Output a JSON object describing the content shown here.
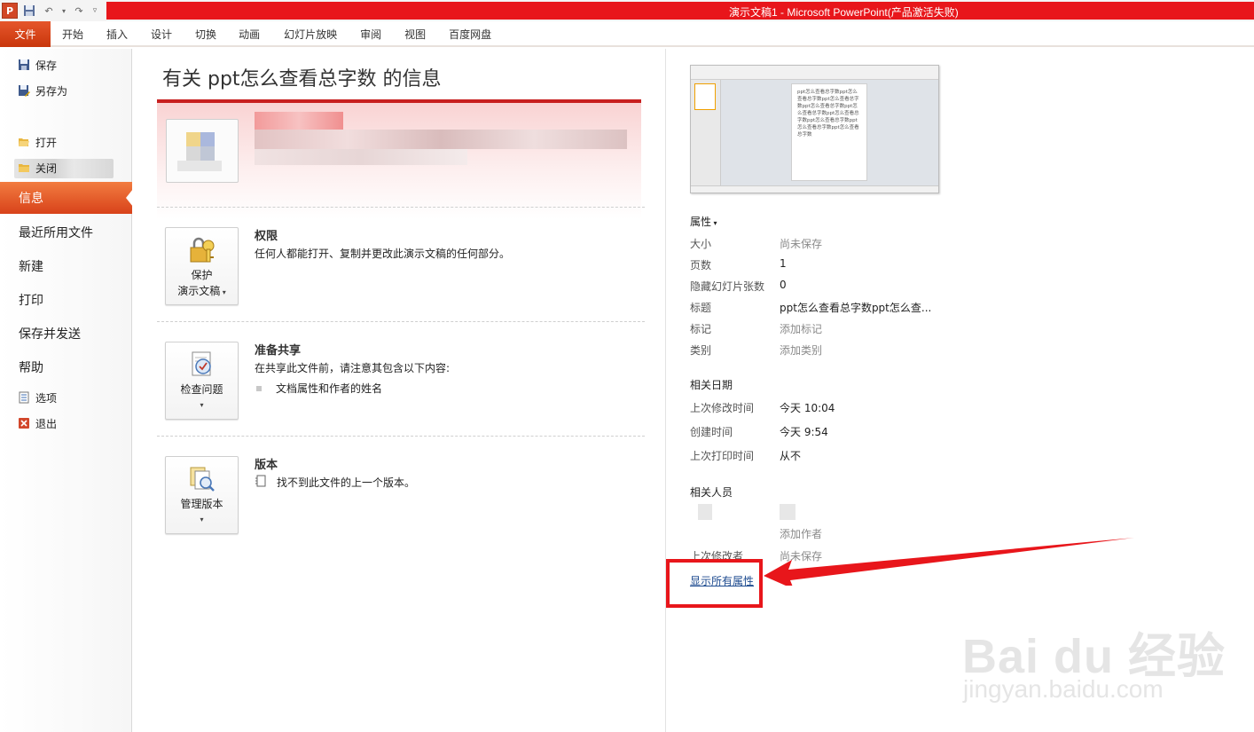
{
  "window": {
    "title": "演示文稿1 - Microsoft PowerPoint(产品激活失败)",
    "app_logo": "P"
  },
  "ribbon_tabs": [
    {
      "label": "文件"
    },
    {
      "label": "开始"
    },
    {
      "label": "插入"
    },
    {
      "label": "设计"
    },
    {
      "label": "切换"
    },
    {
      "label": "动画"
    },
    {
      "label": "幻灯片放映"
    },
    {
      "label": "审阅"
    },
    {
      "label": "视图"
    },
    {
      "label": "百度网盘"
    }
  ],
  "nav": {
    "save": "保存",
    "save_as": "另存为",
    "open": "打开",
    "close": "关闭",
    "info": "信息",
    "recent": "最近所用文件",
    "new": "新建",
    "print": "打印",
    "save_send": "保存并发送",
    "help": "帮助",
    "options": "选项",
    "exit": "退出"
  },
  "main": {
    "title": "有关 ppt怎么查看总字数 的信息",
    "permissions": {
      "button_line1": "保护",
      "button_line2": "演示文稿",
      "title": "权限",
      "desc": "任何人都能打开、复制并更改此演示文稿的任何部分。"
    },
    "prepare": {
      "button_label": "检查问题",
      "title": "准备共享",
      "desc": "在共享此文件前，请注意其包含以下内容:",
      "bullet": "文档属性和作者的姓名"
    },
    "versions": {
      "button_label": "管理版本",
      "title": "版本",
      "desc": "找不到此文件的上一个版本。"
    }
  },
  "properties": {
    "thumbnail_text": "ppt怎么查看总字数ppt怎么查看总字数ppt怎么查看总字数ppt怎么查看总字数ppt怎么查看总字数ppt怎么查看总字数ppt怎么查看总字数ppt怎么查看总字数ppt怎么查看总字数",
    "header": "属性",
    "rows": [
      {
        "label": "大小",
        "value": "尚未保存"
      },
      {
        "label": "页数",
        "value": "1"
      },
      {
        "label": "隐藏幻灯片张数",
        "value": "0"
      },
      {
        "label": "标题",
        "value": "ppt怎么查看总字数ppt怎么查..."
      },
      {
        "label": "标记",
        "value": "添加标记"
      },
      {
        "label": "类别",
        "value": "添加类别"
      }
    ],
    "dates_header": "相关日期",
    "dates": [
      {
        "label": "上次修改时间",
        "value": "今天 10:04"
      },
      {
        "label": "创建时间",
        "value": "今天 9:54"
      },
      {
        "label": "上次打印时间",
        "value": "从不"
      }
    ],
    "people_header": "相关人员",
    "add_author": "添加作者",
    "last_modified_by_label": "上次修改者",
    "last_modified_by_value": "尚未保存",
    "show_all_link": "显示所有属性"
  },
  "watermark": {
    "brand": "Bai du 经验",
    "url": "jingyan.baidu.com"
  },
  "colors": {
    "accent": "#d24726",
    "title_bar_red": "#e8161b",
    "link": "#1c4a8f"
  }
}
